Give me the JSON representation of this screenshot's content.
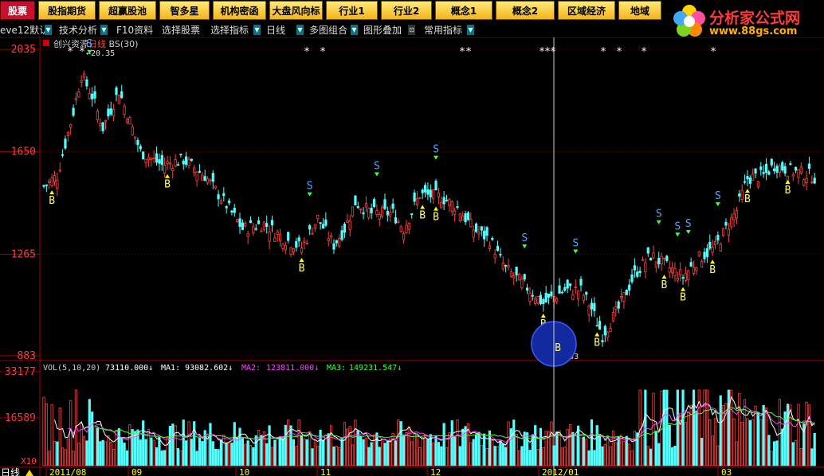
{
  "topbar": {
    "buttons": [
      {
        "label": "股票",
        "active": true
      },
      {
        "label": "股指期货"
      },
      {
        "label": "超赢股池"
      },
      {
        "label": "智多星"
      },
      {
        "label": "机构密函"
      },
      {
        "label": "大盘风向标"
      },
      {
        "label": "行业1"
      },
      {
        "label": "行业2"
      },
      {
        "label": "概念1"
      },
      {
        "label": "概念2"
      },
      {
        "label": "区域经济"
      },
      {
        "label": "地域"
      }
    ]
  },
  "logo": {
    "title": "分析家公式网",
    "url": "www.88gs.com"
  },
  "toolbar": {
    "items": [
      {
        "label": "eve12默认"
      },
      {
        "label": "技术分析"
      },
      {
        "label": "F10资料"
      },
      {
        "label": "选择股票"
      },
      {
        "label": "选择指标"
      },
      {
        "label": "日线"
      },
      {
        "label": "多图组合"
      },
      {
        "label": "图形叠加"
      },
      {
        "label": "常用指标"
      }
    ]
  },
  "chart_data": {
    "type": "candlestick",
    "title": "创兴资源",
    "period": "日线",
    "indicator": "BS(30)",
    "price_axis": {
      "labels": [
        "2035",
        "1650",
        "1265",
        "883"
      ],
      "ylim": [
        883,
        2035
      ]
    },
    "high_label": "20.35",
    "low_label": "8.83",
    "buy_marker": "B",
    "sell_marker": "S",
    "buy_days": [
      3,
      46,
      96,
      141,
      146,
      186,
      206,
      231,
      238,
      249,
      262,
      277
    ],
    "sell_days": [
      17,
      99,
      124,
      146,
      179,
      198,
      229,
      236,
      240,
      251
    ],
    "volume": {
      "header": "VOL(5,10,20)",
      "value": "73110.000",
      "ma1": {
        "label": "MA1:",
        "value": "93082.602"
      },
      "ma2": {
        "label": "MA2:",
        "value": "123811.000"
      },
      "ma3": {
        "label": "MA3:",
        "value": "149231.547"
      },
      "axis_labels": [
        "33177",
        "16589"
      ],
      "unit": "X10"
    },
    "x_labels": [
      "2011/08",
      "09",
      "10",
      "11",
      "12",
      "2012/01",
      "03"
    ],
    "statusbar": "日线",
    "colors": {
      "up": "#ff4040",
      "down": "#54ffff",
      "ma1": "#ffffff",
      "ma2": "#ff40ff",
      "ma3": "#40ff40",
      "grid": "#a00000"
    }
  }
}
